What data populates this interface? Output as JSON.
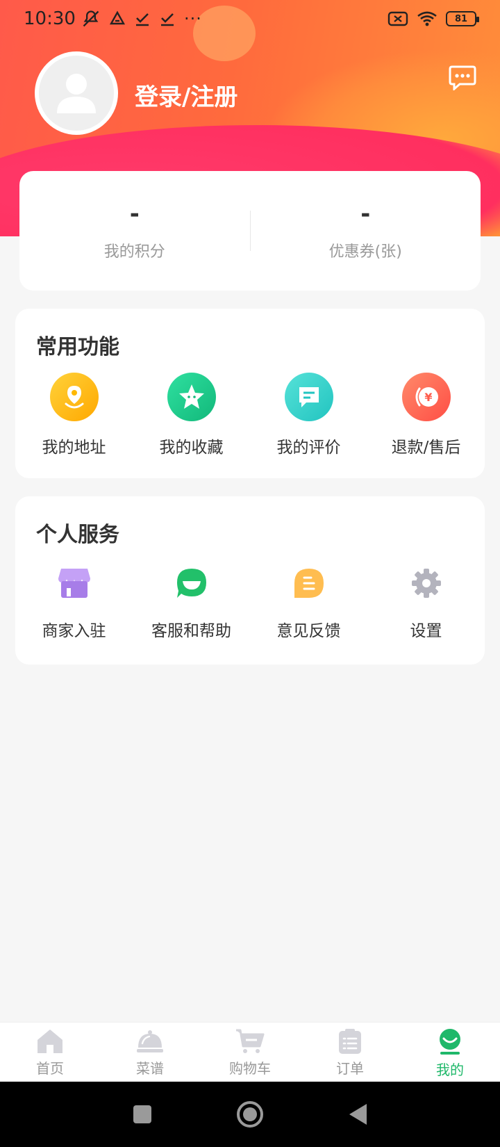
{
  "status_bar": {
    "time": "10:30",
    "battery": "81",
    "icons": [
      "mute-icon",
      "drive-icon",
      "download-done-icon",
      "download-done-icon",
      "more-dots-icon",
      "no-sim-icon",
      "wifi-icon",
      "battery-icon"
    ],
    "more": "···"
  },
  "profile": {
    "login_label": "登录/注册"
  },
  "points": {
    "my_points_value": "-",
    "my_points_label": "我的积分",
    "coupons_value": "-",
    "coupons_label": "优惠券(张)"
  },
  "common_functions": {
    "title": "常用功能",
    "items": [
      {
        "label": "我的地址",
        "icon": "location-icon",
        "color": "#ffb400"
      },
      {
        "label": "我的收藏",
        "icon": "star-icon",
        "color": "#1dc98a"
      },
      {
        "label": "我的评价",
        "icon": "comment-icon",
        "color": "#33d1c9"
      },
      {
        "label": "退款/售后",
        "icon": "refund-icon",
        "color": "#ff6a55"
      }
    ]
  },
  "personal_services": {
    "title": "个人服务",
    "items": [
      {
        "label": "商家入驻",
        "icon": "store-icon",
        "color": "#b68cf2"
      },
      {
        "label": "客服和帮助",
        "icon": "customer-service-icon",
        "color": "#23c06c"
      },
      {
        "label": "意见反馈",
        "icon": "feedback-icon",
        "color": "#ffb84d"
      },
      {
        "label": "设置",
        "icon": "settings-icon",
        "color": "#b3b3bd"
      }
    ]
  },
  "bottom_nav": {
    "items": [
      {
        "label": "首页",
        "icon": "home-icon"
      },
      {
        "label": "菜谱",
        "icon": "recipe-icon"
      },
      {
        "label": "购物车",
        "icon": "cart-icon"
      },
      {
        "label": "订单",
        "icon": "orders-icon"
      },
      {
        "label": "我的",
        "icon": "profile-icon",
        "active": true
      }
    ],
    "active_color": "#1fb86a",
    "inactive_color": "#cfcfd4"
  }
}
